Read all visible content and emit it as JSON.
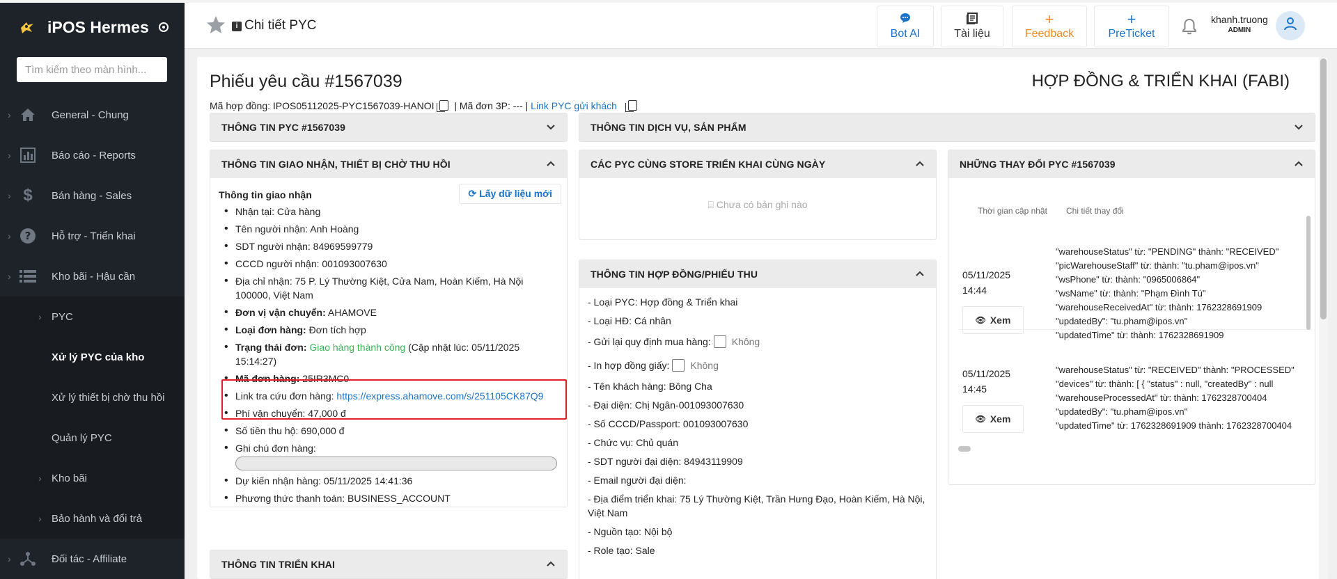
{
  "app": {
    "title": "iPOS Hermes"
  },
  "sidebar": {
    "search_placeholder": "Tìm kiếm theo màn hình...",
    "items": [
      {
        "label": "General - Chung",
        "icon": "home-icon"
      },
      {
        "label": "Báo cáo - Reports",
        "icon": "chart-icon"
      },
      {
        "label": "Bán hàng - Sales",
        "icon": "dollar-icon"
      },
      {
        "label": "Hỗ trợ - Triển khai",
        "icon": "help-icon"
      },
      {
        "label": "Kho bãi - Hậu cần",
        "icon": "list-icon"
      }
    ],
    "subitems": [
      {
        "label": "PYC",
        "chevron": true
      },
      {
        "label": "Xử lý PYC của kho",
        "chevron": false,
        "active": true
      },
      {
        "label": "Xử lý thiết bị chờ thu hồi",
        "chevron": false
      },
      {
        "label": "Quản lý PYC",
        "chevron": false
      },
      {
        "label": "Kho bãi",
        "chevron": true
      },
      {
        "label": "Bảo hành và đổi trả",
        "chevron": true
      }
    ],
    "last_item": {
      "label": "Đối tác - Affiliate",
      "icon": "network-icon"
    }
  },
  "header": {
    "title": "Chi tiết PYC",
    "buttons": {
      "bot": "Bot AI",
      "docs": "Tài liệu",
      "feedback": "Feedback",
      "preticket": "PreTicket"
    },
    "user": {
      "name": "khanh.truong",
      "role": "ADMIN"
    }
  },
  "page": {
    "title": "Phiếu yêu cầu #1567039",
    "category": "HỢP ĐỒNG & TRIỂN KHAI (FABI)",
    "contract_prefix": "Mã hợp đồng: IPOS05112025-PYC1567039-HANOI",
    "order3p": "| Mã đơn 3P: --- |",
    "link_label": "Link PYC gửi khách"
  },
  "cards": {
    "info_pyc": "THÔNG TIN PYC #1567039",
    "service": "THÔNG TIN DỊCH VỤ, SẢN PHẨM",
    "delivery": "THÔNG TIN GIAO NHẬN, THIẾT BỊ CHỜ THU HỒI",
    "same_store": "CÁC PYC CÙNG STORE TRIỂN KHAI CÙNG NGÀY",
    "contract": "THÔNG TIN HỢP ĐỒNG/PHIẾU THU",
    "changes": "NHỮNG THAY ĐỔI PYC #1567039",
    "deploy": "THÔNG TIN TRIỂN KHAI"
  },
  "delivery": {
    "heading": "Thông tin giao nhận",
    "refresh": "Lấy dữ liệu mới",
    "receive_at": "Nhận tại: Cửa hàng",
    "receiver_name": "Tên người nhận: Anh Hoàng",
    "receiver_phone": "SDT người nhận: 84969599779",
    "receiver_id": "CCCD người nhận: 001093007630",
    "address": "Địa chỉ nhận: 75 P. Lý Thường Kiệt, Cửa Nam, Hoàn Kiếm, Hà Nội 100000, Việt Nam",
    "carrier_label": "Đơn vị vận chuyển:",
    "carrier": "AHAMOVE",
    "type_label": "Loại đơn hàng:",
    "type": "Đơn tích hợp",
    "status_label": "Trạng thái đơn:",
    "status": "Giao hàng thành công",
    "status_updated": "(Cập nhật lúc: 05/11/2025 15:14:27)",
    "code_label": "Mã đơn hàng:",
    "code": "25IR3MC0",
    "tracking_label": "Link tra cứu đơn hàng:",
    "tracking_url": "https://express.ahamove.com/s/251105CK87Q9",
    "shipping_fee": "Phí vận chuyển: 47,000 đ",
    "cod": "Số tiền thu hộ: 690,000 đ",
    "note_label": "Ghi chú đơn hàng:",
    "expected": "Dự kiến nhận hàng: 05/11/2025 14:41:36",
    "payment": "Phương thức thanh toán: BUSINESS_ACCOUNT"
  },
  "same_store": {
    "empty": "Chưa có bản ghi nào"
  },
  "contract": {
    "type": "- Loại PYC: Hợp đồng & Triển khai",
    "hd_type": "- Loại HĐ: Cá nhân",
    "resend_label": "- Gửi lại quy định mua hàng:",
    "resend_value": "Không",
    "print_label": "- In hợp đồng giấy:",
    "print_value": "Không",
    "customer": "- Tên khách hàng: Bông Cha",
    "rep": "- Đại diện: Chị Ngân-001093007630",
    "passport": "- Số CCCD/Passport: 001093007630",
    "position": "- Chức vụ: Chủ quán",
    "rep_phone": "- SDT người đại diện: 84943119909",
    "rep_email": "- Email người đại diện:",
    "deploy_place": "- Địa điểm triển khai: 75 Lý Thường Kiệt, Trần Hưng Đạo, Hoàn Kiếm, Hà Nội, Việt Nam",
    "source": "- Nguồn tạo: Nội bộ",
    "role": "- Role tạo: Sale"
  },
  "changes": {
    "col_time": "Thời gian cập nhật",
    "col_detail": "Chi tiết thay đổi",
    "view": "Xem",
    "rows": [
      {
        "date": "05/11/2025",
        "time": "14:44",
        "lines": [
          "\"warehouseStatus\" từ: \"PENDING\" thành: \"RECEIVED\"",
          "\"picWarehouseStaff\" từ: thành: \"tu.pham@ipos.vn\"",
          "\"wsPhone\" từ: thành: \"0965006864\"",
          "\"wsName\" từ: thành: \"Phạm Đình Tú\"",
          "\"warehouseReceivedAt\" từ: thành: 1762328691909",
          "\"updatedBy\": \"tu.pham@ipos.vn\"",
          "\"updatedTime\" từ: thành: 1762328691909"
        ]
      },
      {
        "date": "05/11/2025",
        "time": "14:45",
        "lines": [
          "\"warehouseStatus\" từ: \"RECEIVED\" thành: \"PROCESSED\"",
          "\"devices\" từ: thành: [ { \"status\" : null, \"createdBy\" : null",
          "\"warehouseProcessedAt\" từ: thành: 1762328700404",
          "\"updatedBy\": \"tu.pham@ipos.vn\"",
          "\"updatedTime\" từ: 1762328691909 thành: 1762328700404"
        ]
      }
    ]
  },
  "colors": {
    "accent": "#1b73c9",
    "sidebar_bg": "#1e2229",
    "success": "#3bb157",
    "highlight": "#e0202b",
    "feedback": "#f08a24"
  }
}
